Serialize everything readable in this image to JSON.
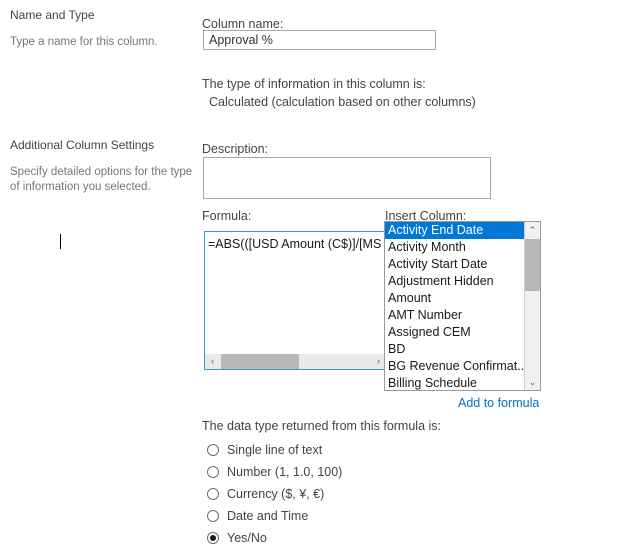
{
  "sections": {
    "name_and_type": {
      "heading": "Name and Type",
      "note": "Type a name for this column."
    },
    "additional_settings": {
      "heading": "Additional Column Settings",
      "note": "Specify detailed options for the type of information you selected."
    }
  },
  "form": {
    "column_name_label": "Column name:",
    "column_name_value": "Approval %",
    "type_info_label": "The type of information in this column is:",
    "type_info_value": "Calculated (calculation based on other columns)",
    "description_label": "Description:",
    "description_value": "",
    "formula_label": "Formula:",
    "formula_value": "=ABS(([USD Amount (C$)]/[MS Sa",
    "insert_column_label": "Insert Column:",
    "add_to_formula_label": "Add to formula",
    "data_type_label": "The data type returned from this formula is:"
  },
  "insert_column_options": [
    "Activity End Date",
    "Activity Month",
    "Activity Start Date",
    "Adjustment Hidden",
    "Amount",
    "AMT Number",
    "Assigned CEM",
    "BD",
    "BG Revenue Confirmat...",
    "Billing Schedule"
  ],
  "insert_column_selected": "Activity End Date",
  "data_type_options": [
    "Single line of text",
    "Number (1, 1.0, 100)",
    "Currency ($, ¥, €)",
    "Date and Time",
    "Yes/No"
  ],
  "data_type_selected": "Yes/No",
  "scroll_arrows": {
    "left": "‹",
    "right": "›",
    "up": "⌃",
    "down": "⌄"
  },
  "colors": {
    "accent_link": "#0072c6",
    "selection_blue": "#0078d7",
    "focus_border": "#2e9ad6",
    "text": "#444444",
    "muted_text": "#767676"
  }
}
